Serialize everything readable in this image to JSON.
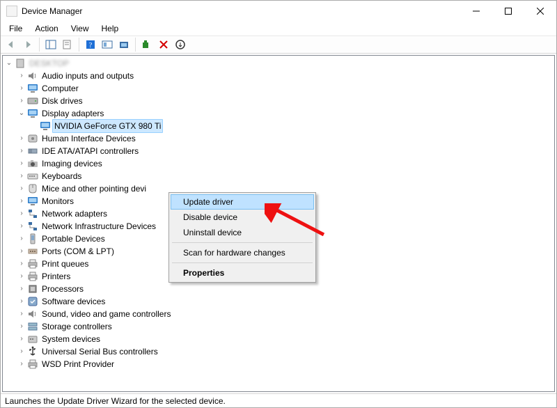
{
  "title": "Device Manager",
  "menu": {
    "items": [
      "File",
      "Action",
      "View",
      "Help"
    ]
  },
  "win_controls": {
    "min": "Minimize",
    "max": "Maximize",
    "close": "Close"
  },
  "toolbar": {
    "back": "Back",
    "forward": "Forward",
    "show_hide_tree": "Show/Hide Console Tree",
    "properties": "Properties",
    "help": "Help",
    "scan": "Scan for hardware changes",
    "update": "Update device drivers",
    "install_legacy": "Add legacy hardware",
    "uninstall": "Uninstall device",
    "enable_disable": "Enable/Disable device"
  },
  "tree": {
    "root": "DESKTOP",
    "categories": [
      {
        "label": "Audio inputs and outputs",
        "expanded": false,
        "icon": "speaker-icon"
      },
      {
        "label": "Computer",
        "expanded": false,
        "icon": "monitor-icon"
      },
      {
        "label": "Disk drives",
        "expanded": false,
        "icon": "disk-icon"
      },
      {
        "label": "Display adapters",
        "expanded": true,
        "icon": "monitor-icon",
        "children": [
          {
            "label": "NVIDIA GeForce GTX 980 Ti",
            "icon": "monitor-icon",
            "selected": true
          }
        ]
      },
      {
        "label": "Human Interface Devices",
        "expanded": false,
        "icon": "hid-icon"
      },
      {
        "label": "IDE ATA/ATAPI controllers",
        "expanded": false,
        "icon": "ata-icon"
      },
      {
        "label": "Imaging devices",
        "expanded": false,
        "icon": "camera-icon"
      },
      {
        "label": "Keyboards",
        "expanded": false,
        "icon": "keyboard-icon"
      },
      {
        "label": "Mice and other pointing devices",
        "expanded": false,
        "icon": "mouse-icon",
        "truncated": "Mice and other pointing devi"
      },
      {
        "label": "Monitors",
        "expanded": false,
        "icon": "monitor-icon"
      },
      {
        "label": "Network adapters",
        "expanded": false,
        "icon": "network-icon"
      },
      {
        "label": "Network Infrastructure Devices",
        "expanded": false,
        "icon": "network-icon"
      },
      {
        "label": "Portable Devices",
        "expanded": false,
        "icon": "portable-icon"
      },
      {
        "label": "Ports (COM & LPT)",
        "expanded": false,
        "icon": "port-icon"
      },
      {
        "label": "Print queues",
        "expanded": false,
        "icon": "printer-icon"
      },
      {
        "label": "Printers",
        "expanded": false,
        "icon": "printer-icon"
      },
      {
        "label": "Processors",
        "expanded": false,
        "icon": "cpu-icon"
      },
      {
        "label": "Software devices",
        "expanded": false,
        "icon": "software-icon"
      },
      {
        "label": "Sound, video and game controllers",
        "expanded": false,
        "icon": "speaker-icon"
      },
      {
        "label": "Storage controllers",
        "expanded": false,
        "icon": "storage-icon"
      },
      {
        "label": "System devices",
        "expanded": false,
        "icon": "system-icon"
      },
      {
        "label": "Universal Serial Bus controllers",
        "expanded": false,
        "icon": "usb-icon"
      },
      {
        "label": "WSD Print Provider",
        "expanded": false,
        "icon": "printer-icon"
      }
    ]
  },
  "context_menu": {
    "items": [
      {
        "label": "Update driver",
        "highlight": true
      },
      {
        "label": "Disable device"
      },
      {
        "label": "Uninstall device"
      },
      {
        "sep": true
      },
      {
        "label": "Scan for hardware changes"
      },
      {
        "sep": true
      },
      {
        "label": "Properties",
        "bold": true
      }
    ]
  },
  "statusbar": "Launches the Update Driver Wizard for the selected device."
}
